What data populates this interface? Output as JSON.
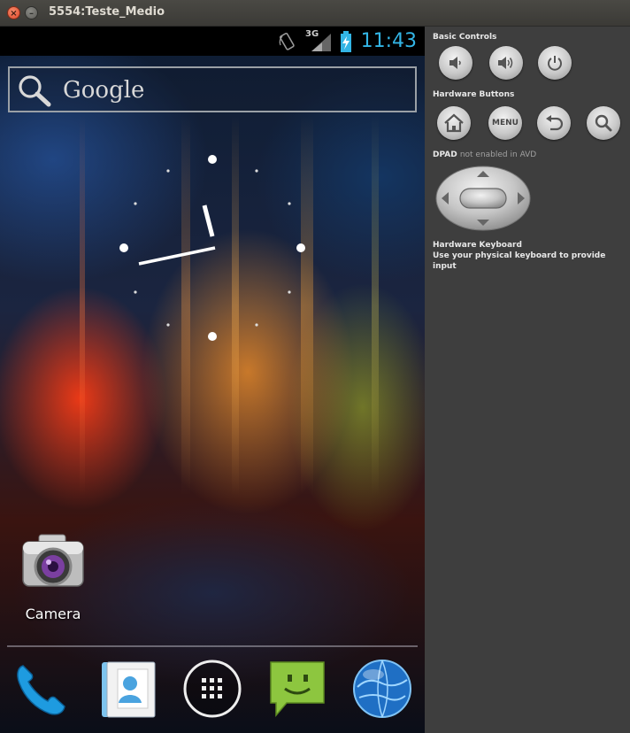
{
  "window": {
    "title": "5554:Teste_Medio",
    "close_glyph": "×",
    "minimize_glyph": "–"
  },
  "status_bar": {
    "time": "11:43",
    "network": "3G",
    "icons": [
      "rotation-lock-icon",
      "signal-icon",
      "battery-charging-icon"
    ]
  },
  "search_widget": {
    "label": "Google",
    "icon": "search-icon"
  },
  "clock_widget": {
    "type": "analog-clock",
    "hour": 11,
    "minute": 43
  },
  "home_icons": [
    {
      "label": "Camera",
      "icon": "camera-icon"
    }
  ],
  "dock": {
    "items": [
      {
        "icon": "phone-icon"
      },
      {
        "icon": "contacts-icon"
      },
      {
        "icon": "all-apps-icon"
      },
      {
        "icon": "messaging-icon"
      },
      {
        "icon": "browser-icon"
      }
    ]
  },
  "panel": {
    "basic_controls_title": "Basic Controls",
    "hardware_buttons_title": "Hardware Buttons",
    "dpad_title": "DPAD",
    "dpad_note": "not enabled in AVD",
    "keyboard_title": "Hardware Keyboard",
    "keyboard_note": "Use your physical keyboard to provide input",
    "menu_label": "MENU",
    "basic_controls": [
      "volume-down-icon",
      "volume-up-icon",
      "power-icon"
    ],
    "hardware_buttons": [
      "home-icon",
      "menu-button",
      "back-icon",
      "search-icon"
    ]
  },
  "colors": {
    "accent": "#33b5e5",
    "panel_bg": "#3e3e3e",
    "titlebar_bg": "#3b3a36"
  }
}
